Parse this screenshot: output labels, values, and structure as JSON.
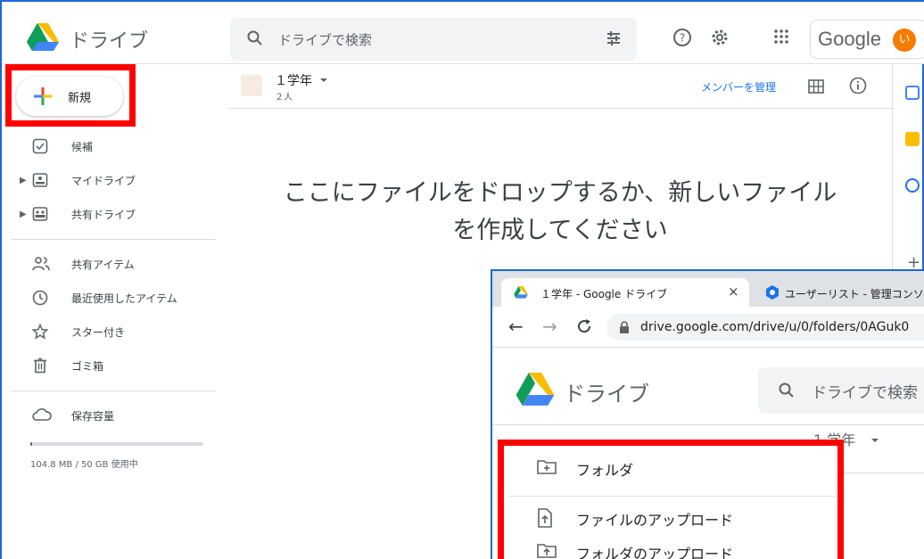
{
  "app": {
    "brand": "ドライブ"
  },
  "search": {
    "placeholder": "ドライブで検索"
  },
  "account": {
    "logo_text": "Google",
    "avatar_initial": "い",
    "avatar_color": "#f57c00"
  },
  "sidebar": {
    "new_label": "新規",
    "items": [
      {
        "label": "候補",
        "icon": "check-square-icon"
      },
      {
        "label": "マイドライブ",
        "icon": "my-drive-icon",
        "expandable": true
      },
      {
        "label": "共有ドライブ",
        "icon": "shared-drives-icon",
        "expandable": true
      },
      {
        "label": "共有アイテム",
        "icon": "people-icon"
      },
      {
        "label": "最近使用したアイテム",
        "icon": "clock-icon"
      },
      {
        "label": "スター付き",
        "icon": "star-icon"
      },
      {
        "label": "ゴミ箱",
        "icon": "trash-icon"
      },
      {
        "label": "保存容量",
        "icon": "cloud-icon"
      }
    ],
    "storage_text": "104.8 MB / 50 GB 使用中",
    "storage_fraction": 0.002
  },
  "folder": {
    "name": "１学年",
    "members": "２人",
    "manage_label": "メンバーを管理"
  },
  "drop_hint": {
    "line1": "ここにファイルをドロップするか、新しいファイル",
    "line2": "を作成してください"
  },
  "popup": {
    "tab1_title": "１学年 - Google ドライブ",
    "tab2_title": "ユーザーリスト - 管理コンソール",
    "url": "drive.google.com/drive/u/0/folders/0AGuk0",
    "brand": "ドライブ",
    "search_placeholder": "ドライブで検索",
    "folder_name": "1 学年",
    "menu": [
      {
        "label": "フォルダ",
        "icon": "new-folder-icon"
      },
      {
        "label": "ファイルのアップロード",
        "icon": "file-upload-icon"
      },
      {
        "label": "フォルダのアップロード",
        "icon": "folder-upload-icon"
      }
    ]
  },
  "colors": {
    "highlight": "#ff0000",
    "frame": "#1e67d6",
    "link": "#1a73e8"
  }
}
